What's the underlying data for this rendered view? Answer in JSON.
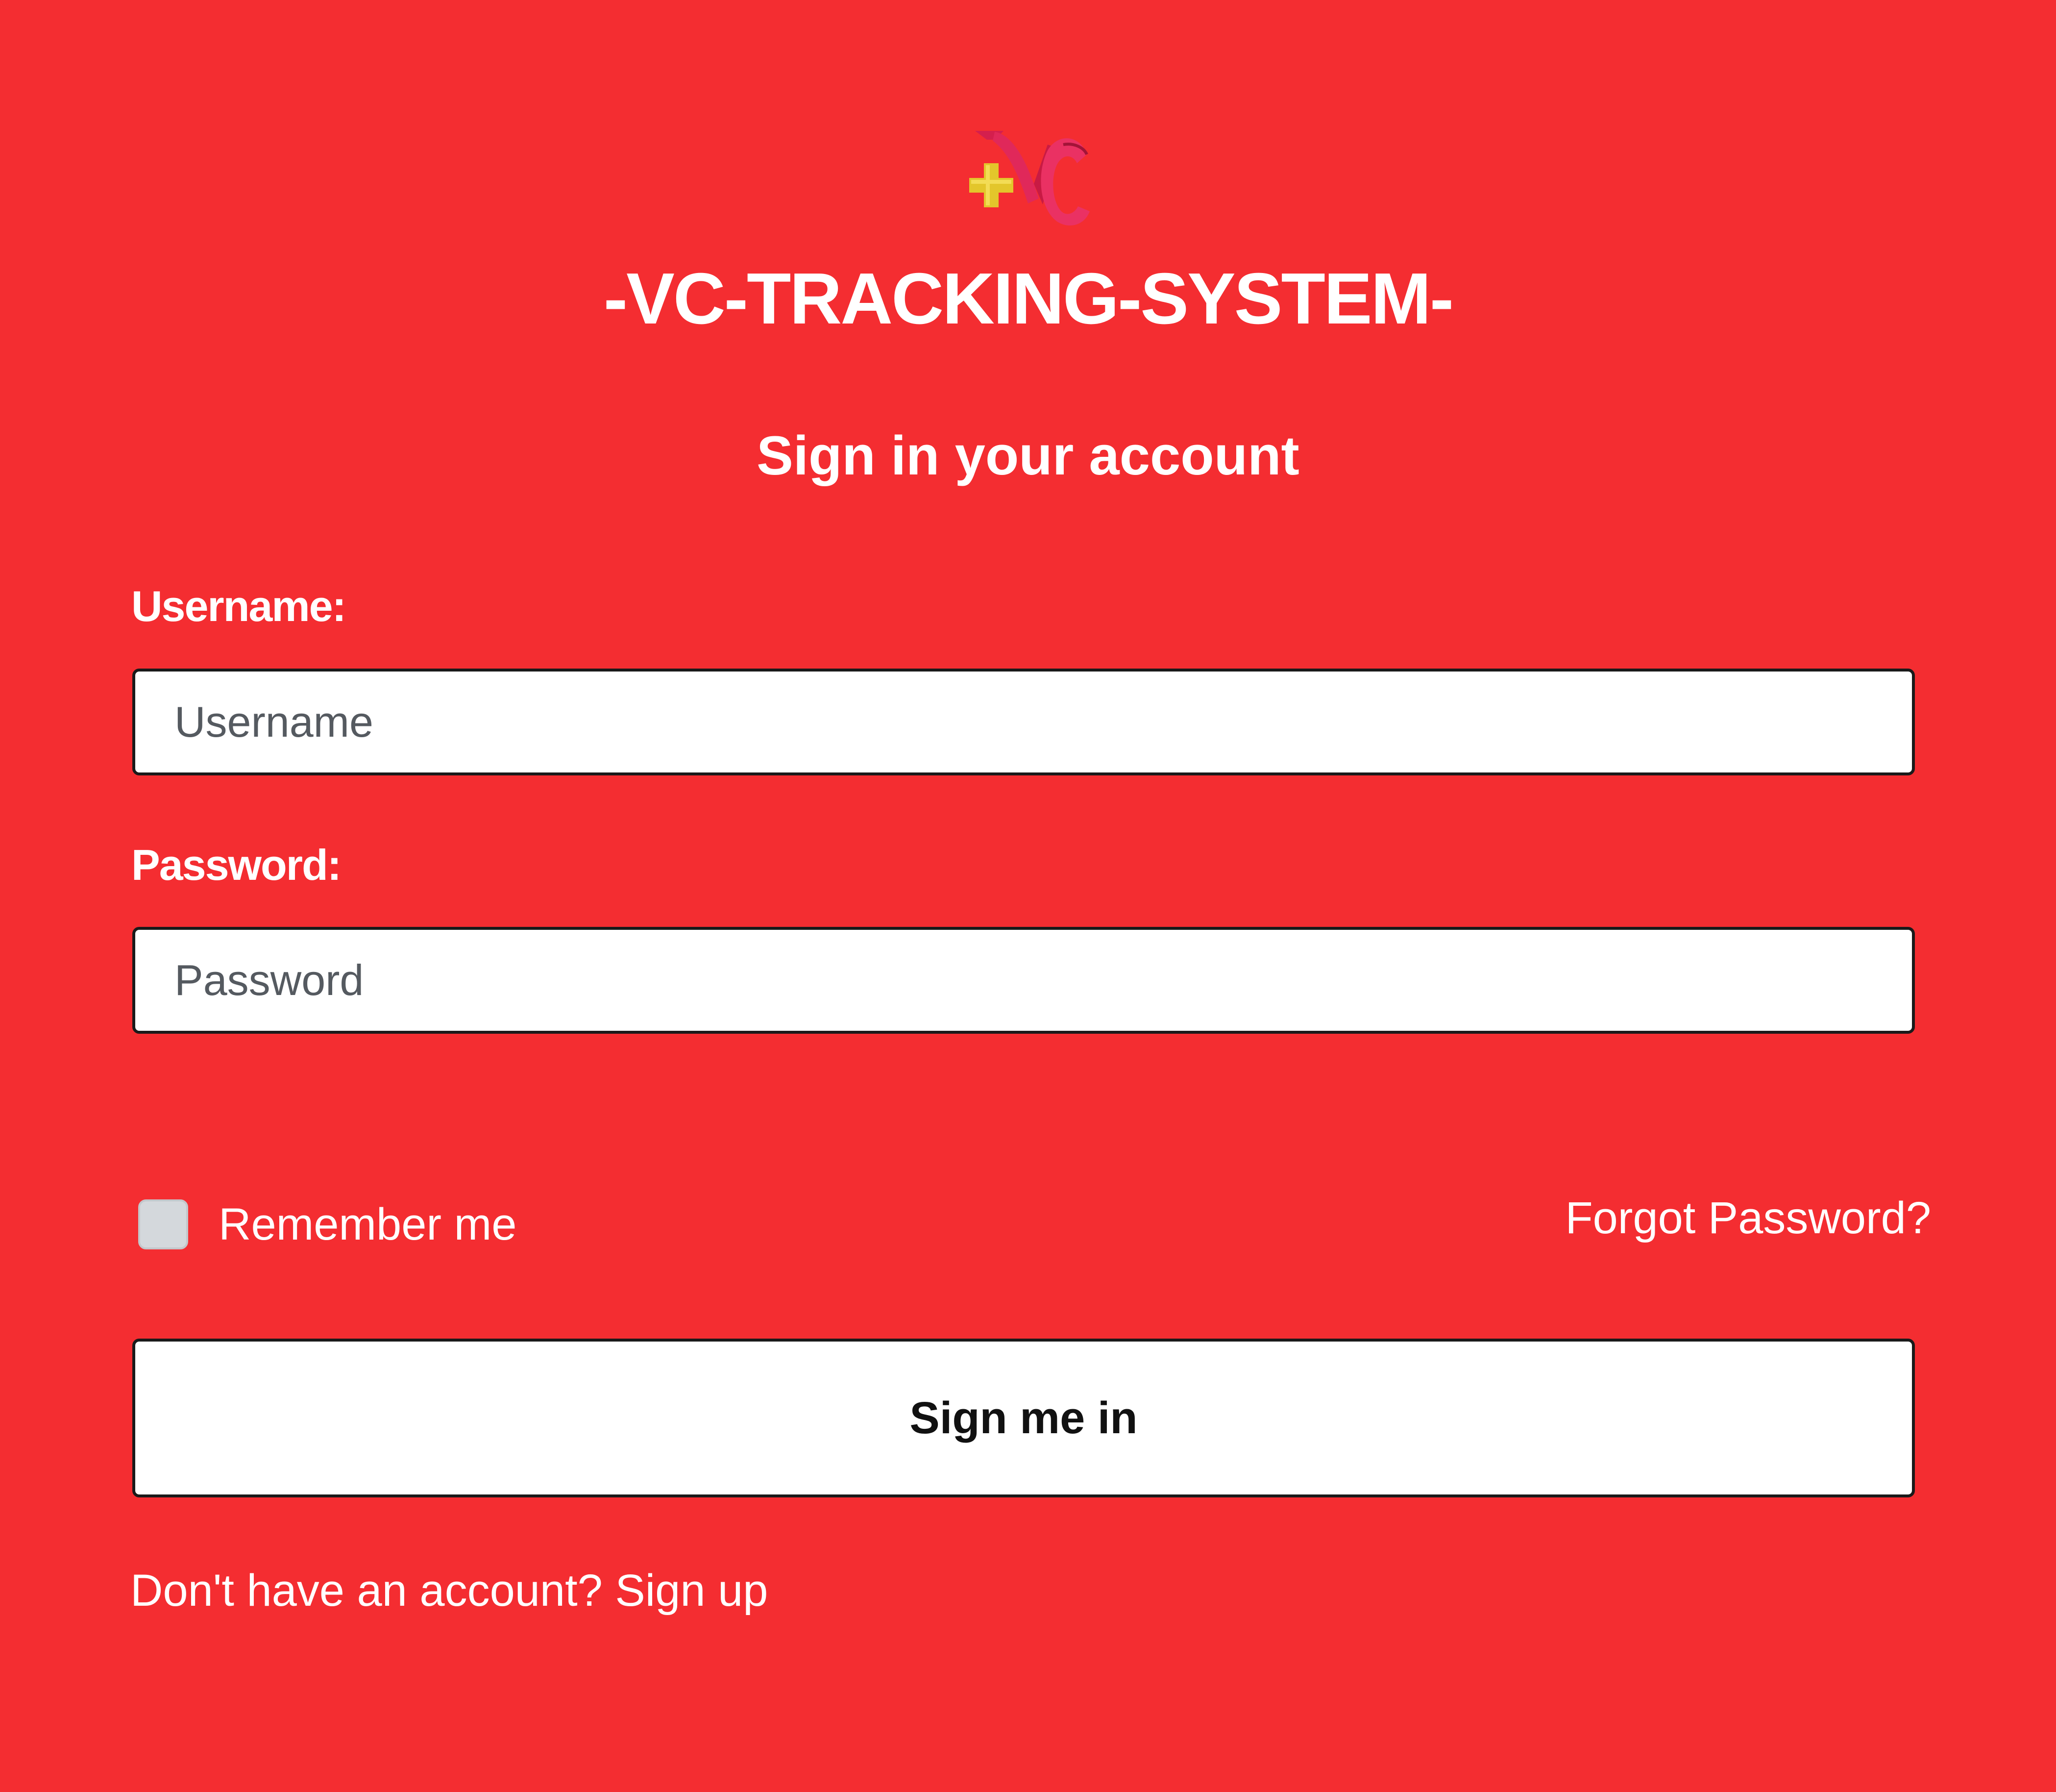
{
  "app": {
    "title": "-VC-TRACKING-SYSTEM-",
    "logo_icon": "vc-plus-logo-icon",
    "background_color": "#f42d31"
  },
  "form": {
    "heading": "Sign in your account",
    "username": {
      "label": "Username:",
      "placeholder": "Username",
      "value": ""
    },
    "password": {
      "label": "Password:",
      "placeholder": "Password",
      "value": ""
    },
    "remember_me": {
      "label": "Remember me",
      "checked": false
    },
    "forgot_password": "Forgot Password?",
    "submit_label": "Sign me in",
    "signup_prompt": "Don't have an account?",
    "signup_link": "Sign up"
  }
}
